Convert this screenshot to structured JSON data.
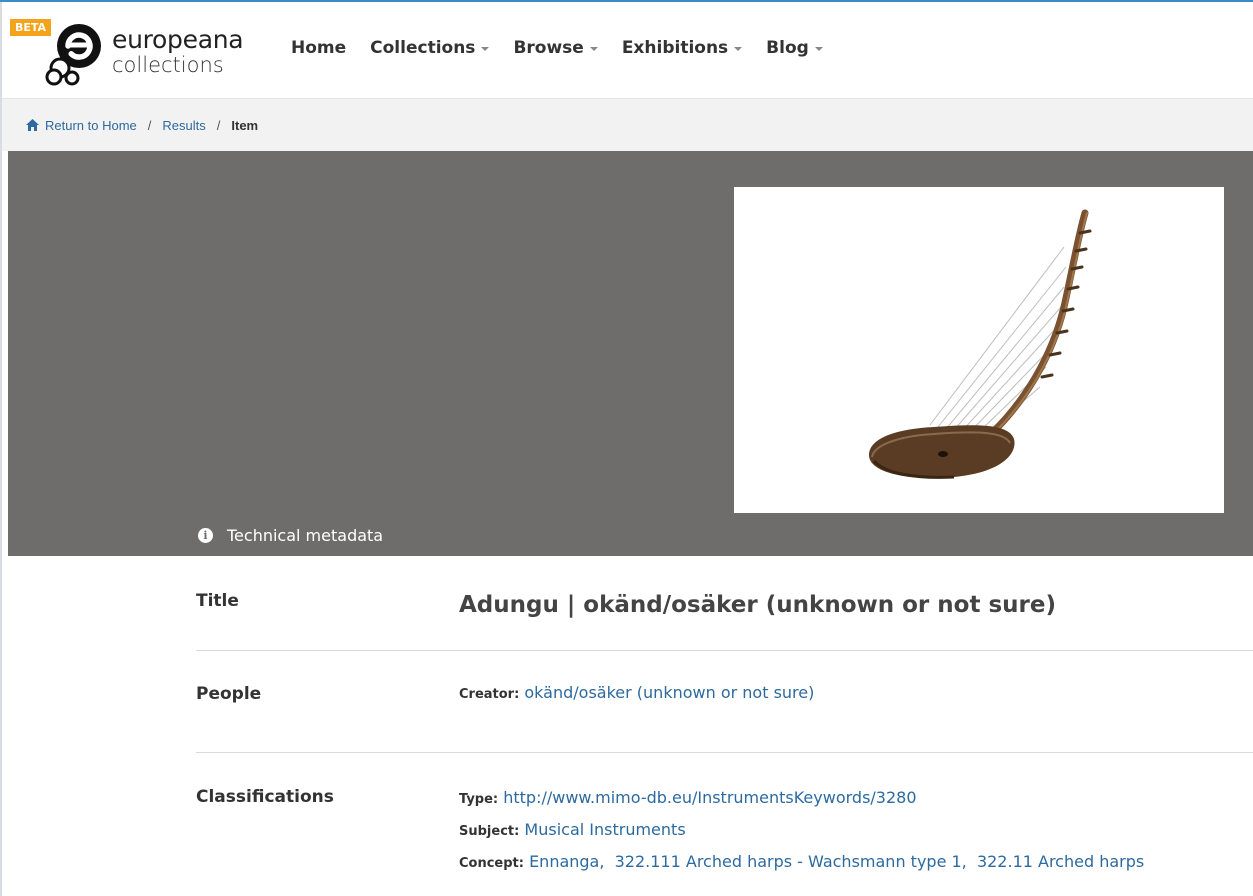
{
  "header": {
    "beta_badge": "BETA",
    "logo": {
      "line1": "europeana",
      "line2": "collections"
    },
    "nav": [
      {
        "label": "Home",
        "has_dropdown": false
      },
      {
        "label": "Collections",
        "has_dropdown": true
      },
      {
        "label": "Browse",
        "has_dropdown": true
      },
      {
        "label": "Exhibitions",
        "has_dropdown": true
      },
      {
        "label": "Blog",
        "has_dropdown": true
      }
    ]
  },
  "breadcrumb": {
    "home": "Return to Home",
    "results": "Results",
    "current": "Item",
    "separator": "/"
  },
  "media": {
    "technical_metadata": "Technical metadata",
    "image_subject": "Adungu arched harp"
  },
  "metadata": {
    "title": {
      "label": "Title",
      "value": "Adungu | okänd/osäker (unknown or not sure)"
    },
    "people": {
      "label": "People",
      "creator_key": "Creator:",
      "creator_value": "okänd/osäker (unknown or not sure)"
    },
    "classifications": {
      "label": "Classifications",
      "type_key": "Type:",
      "type_value": "http://www.mimo-db.eu/InstrumentsKeywords/3280",
      "subject_key": "Subject:",
      "subject_value": "Musical Instruments",
      "concept_key": "Concept:",
      "concepts": [
        "Ennanga,",
        "322.111 Arched harps - Wachsmann type 1,",
        "322.11 Arched harps"
      ]
    }
  },
  "colors": {
    "accent": "#f3a41b",
    "link": "#2d6a9f",
    "media_bg": "#6e6d6b",
    "breadcrumb_bg": "#f2f2f2"
  }
}
